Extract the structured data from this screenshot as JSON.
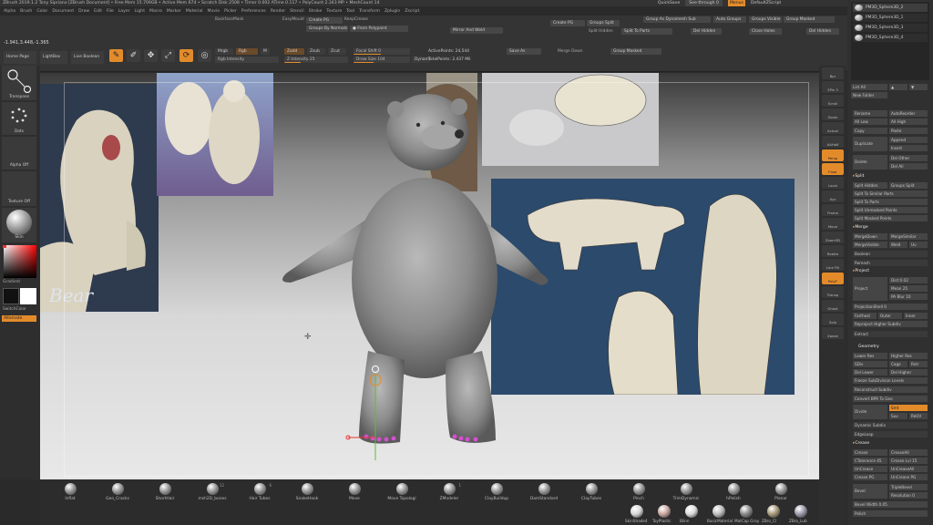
{
  "title_bar": "ZBrush 2019.1.2  Tony Sipriano [ZBrush Document]  • Free Mem 15.709GB • Active Mem 674 • Scratch Disk 2508 • Timer 0.002 ATime 0.117 • PolyCount 2.343 MP • MeshCount 14",
  "quicksave": {
    "label": "QuickSave",
    "seethrough": "See-through  0",
    "menus": "Menus",
    "script": "DefaultZScript"
  },
  "menus": [
    "Alpha",
    "Brush",
    "Color",
    "Document",
    "Draw",
    "Edit",
    "File",
    "Layer",
    "Light",
    "Macro",
    "Marker",
    "Material",
    "Movie",
    "Picker",
    "Preferences",
    "Render",
    "Stencil",
    "Stroke",
    "Texture",
    "Tool",
    "Transform",
    "Zplugin",
    "Zscript"
  ],
  "coords": "-1.941,3.448,-1.365",
  "toolbar": {
    "home_page": "Home Page",
    "lightbox": "LightBox",
    "live_boolean": "Live Boolean",
    "edit": "Edit",
    "draw": "Draw",
    "move": "Move",
    "scale": "Scale",
    "rotate": "Rotate",
    "mrgb": "Mrgb",
    "rgb": "Rgb",
    "m": "M",
    "zadd": "Zadd",
    "zsub": "Zsub",
    "zcut": "Zcut",
    "rgb_intensity": "Rgb Intensity",
    "z_intensity": "Z Intensity  25",
    "focal_shift": "Focal Shift  0",
    "draw_size": "Draw Size  104",
    "dynamic": "Dynamic",
    "active_points": "ActivePoints: 24,544",
    "total_points": "TotalPoints: 2.437 Mil",
    "backface_mask": "BackfaceMask",
    "easy_mode": "EasyMould",
    "create_pg": "Create PG",
    "keep_creases": "KeepCrease",
    "groups_by_normals": "Groups By Normals",
    "from_polypaint": "From Polypaint",
    "mirror_and_weld": "Mirror And Weld",
    "save_as": "Save As",
    "merge_down": "Merge Down",
    "group_masked": "Group Masked",
    "create_pg2": "Create PG",
    "groups_split": "Groups Split",
    "split_hidden": "Split Hidden",
    "split_to_parts": "Split To Parts",
    "group_as_dynamesh_sub": "Group As Dynamesh Sub",
    "del_hidden": "Del Hidden",
    "auto_groups": "Auto Groups",
    "close_holes": "Close Holes",
    "groups_visible": "Groups Visible",
    "group_masked2": "Group Masked",
    "del_hidden2": "Del Hidden"
  },
  "left_shelf": {
    "transpose": "Transpose",
    "dots": "Dots",
    "alpha_off": "Alpha Off",
    "texture_off": "Texture Off",
    "skin": "Skin",
    "gradient": "Gradient",
    "switch_color": "SwitchColor",
    "alternate": "Alternate",
    "colors": {
      "primary": "#111111",
      "secondary": "#ffffff"
    }
  },
  "right_shelf": {
    "items": [
      "Bpr",
      "SPix 3",
      "Scroll",
      "Zoom",
      "Actual",
      "AAHalf",
      "Persp",
      "Floor",
      "Local",
      "Xyz",
      "Frame",
      "Move",
      "Zoom3D",
      "Rotate",
      "Line Fill",
      "PolyF",
      "Transp",
      "Ghost",
      "Solo",
      "Xpose"
    ]
  },
  "palette": {
    "subtools": [
      "PM3D_Sphere3D_2",
      "PM3D_Sphere3D_1",
      "PM3D_Sphere3D_3",
      "PM3D_Sphere3D_4"
    ],
    "list_all": "List All",
    "new_folder": "New Folder",
    "rename": "Rename",
    "auto_reorder": "AutoReorder",
    "all_low": "All Low",
    "all_high": "All High",
    "copy": "Copy",
    "paste": "Paste",
    "duplicate": "Duplicate",
    "append": "Append",
    "insert": "Insert",
    "delete": "Delete",
    "del_other": "Del Other",
    "del_all": "Del All",
    "split": "Split",
    "split_hidden": "Split Hidden",
    "groups_split": "Groups Split",
    "split_to_similar": "Split To Similar Parts",
    "split_to_parts": "Split To Parts",
    "split_unmasked": "Split Unmasked Points",
    "split_masked": "Split Masked Points",
    "merge": "Merge",
    "merge_down": "MergeDown",
    "merge_similar": "MergeSimilar",
    "merge_visible": "MergeVisible",
    "weld": "Weld",
    "uv": "Uv",
    "boolean": "Boolean",
    "remesh": "Remesh",
    "project": "Project",
    "projectbtn": "Project",
    "dist": "Dist  0.02",
    "mean": "Mean  25",
    "pa_blur": "PA Blur  10",
    "project_shell": "ProjectionShell  0",
    "farthest": "Farthest",
    "outer": "Outer",
    "inner": "Inner",
    "reproject_higher": "Reproject Higher Subdiv",
    "extract": "Extract",
    "geometry": "Geometry",
    "lower_res": "Lower Res",
    "higher_res": "Higher Res",
    "sdiv": "SDiv",
    "cage": "Cage",
    "rstr": "Rstr",
    "del_lower": "Del Lower",
    "del_higher": "Del Higher",
    "freeze_subdiv": "Freeze SubDivision Levels",
    "reconstruct": "Reconstruct Subdiv",
    "convert_bpr": "Convert BPR To Geo",
    "divide": "Divide",
    "smt": "Smt",
    "suv": "Suv",
    "reuv": "ReUV",
    "dynamic_subdiv": "Dynamic Subdiv",
    "edgeloop": "EdgeLoop",
    "crease": "Crease",
    "crease_btn": "Crease",
    "crease_all": "CreaseAll",
    "crease_lvl": "CTolerance  45",
    "crease_lvl2": "Crease Lvl  15",
    "uncrease": "UnCrease",
    "uncrease_all": "UnCreaseAll",
    "crease_pg": "Crease PG",
    "uncrease_pg": "UnCrease PG",
    "bevel": "Bevel",
    "triple_bevel": "TripleBevel",
    "resolution": "Resolution  0",
    "bevel_width": "Bevel Width  0.05",
    "polish": "Polish"
  },
  "brushes": [
    {
      "name": "Inflat"
    },
    {
      "name": "Geo_Cracks"
    },
    {
      "name": "ShortHair"
    },
    {
      "name": "msh2D_bones"
    },
    {
      "name": "Hair Tubes"
    },
    {
      "name": "SnakeHook"
    },
    {
      "name": "Move"
    },
    {
      "name": "Move Topologi"
    },
    {
      "name": "ZModeler"
    },
    {
      "name": "ClayBuildup"
    },
    {
      "name": "DamStandard"
    },
    {
      "name": "ClayTubes"
    },
    {
      "name": "Pinch"
    },
    {
      "name": "TrimDynamic"
    },
    {
      "name": "hPolish"
    },
    {
      "name": "Planar"
    }
  ],
  "brush_counts": {
    "msh2D_bones": "12",
    "Hair Tubes": "6",
    "ZModeler": "1"
  },
  "materials": [
    "SkinShade4",
    "ToyPlastic",
    "Blinn",
    "BasicMaterial",
    "MatCap Gray",
    "ZBro_Cl",
    "ZBro_Lub"
  ],
  "reference_caption": "Bear"
}
